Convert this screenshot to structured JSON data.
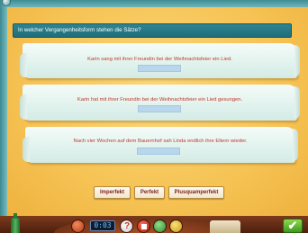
{
  "question": {
    "title": "In welcher Vergangenheitsform stehen die Sätze?"
  },
  "sentences": [
    {
      "text": "Karin sang mit ihrer Freundin bei der Weihnachtsfeier ein Lied."
    },
    {
      "text": "Karin hat mit ihrer Freundin bei der Weihnachtsfeier ein Lied gesungen."
    },
    {
      "text": "Nach vier Wochen auf dem Bauernhof sah Linda endlich ihre Eltern wieder."
    }
  ],
  "options": [
    {
      "label": "Imperfekt"
    },
    {
      "label": "Perfekt"
    },
    {
      "label": "Plusquamperfekt"
    }
  ],
  "toolbar": {
    "clock_text": "0:03",
    "check_symbol": "✔",
    "icons": [
      "bottle-icon",
      "book-icon",
      "clock-display",
      "help-icon",
      "stop-icon",
      "green-book-icon",
      "yellow-book-icon",
      "pages-icon",
      "check-icon"
    ]
  },
  "colors": {
    "panel": "#f6c354",
    "title_bar": "#2f8592",
    "sentence_text": "#c0392b",
    "answer_slot": "#b9d7ec",
    "check_button": "#5cb82f"
  }
}
